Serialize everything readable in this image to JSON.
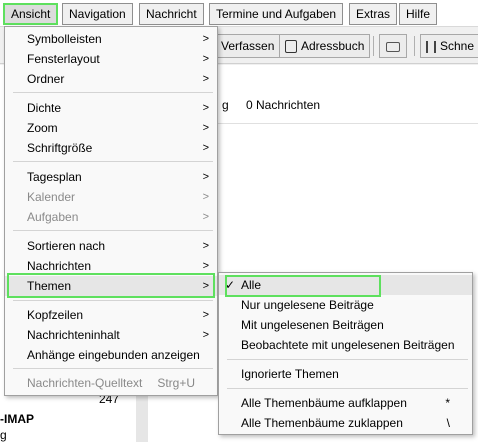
{
  "menubar": {
    "items": [
      "Ansicht",
      "Navigation",
      "Nachricht",
      "Termine und Aufgaben",
      "Extras",
      "Hilfe"
    ]
  },
  "toolbar": {
    "write_label": "Verfassen",
    "addressbook_label": "Adressbuch",
    "filter_label": "Schne"
  },
  "message_header": {
    "fragment": "g",
    "count_label": "0 Nachrichten"
  },
  "left_pane": {
    "count": "247",
    "folder_fragment": "-IMAP",
    "fragment2": "g"
  },
  "view_menu": {
    "items": [
      {
        "label": "Symbolleisten",
        "submenu": true
      },
      {
        "label": "Fensterlayout",
        "submenu": true
      },
      {
        "label": "Ordner",
        "submenu": true
      },
      {
        "label": "Dichte",
        "submenu": true
      },
      {
        "label": "Zoom",
        "submenu": true
      },
      {
        "label": "Schriftgröße",
        "submenu": true
      },
      {
        "label": "Tagesplan",
        "submenu": true
      },
      {
        "label": "Kalender",
        "submenu": true,
        "disabled": true
      },
      {
        "label": "Aufgaben",
        "submenu": true,
        "disabled": true
      },
      {
        "label": "Sortieren nach",
        "submenu": true
      },
      {
        "label": "Nachrichten",
        "submenu": true
      },
      {
        "label": "Themen",
        "submenu": true,
        "highlighted": true
      },
      {
        "label": "Kopfzeilen",
        "submenu": true
      },
      {
        "label": "Nachrichteninhalt",
        "submenu": true
      },
      {
        "label": "Anhänge eingebunden anzeigen",
        "submenu": false
      },
      {
        "label": "Nachrichten-Quelltext",
        "accel": "Strg+U",
        "disabled": true
      }
    ]
  },
  "themes_menu": {
    "items": [
      {
        "label": "Alle",
        "checked": true
      },
      {
        "label": "Nur ungelesene Beiträge"
      },
      {
        "label": "Mit ungelesenen Beiträgen"
      },
      {
        "label": "Beobachtete mit ungelesenen Beiträgen"
      },
      {
        "label": "Ignorierte Themen"
      },
      {
        "label": "Alle Themenbäume aufklappen",
        "accel": "*"
      },
      {
        "label": "Alle Themenbäume zuklappen",
        "accel": "\\"
      }
    ]
  },
  "colors": {
    "highlight_outline": "#5ee05e",
    "menu_bg": "#f9f9f9"
  }
}
